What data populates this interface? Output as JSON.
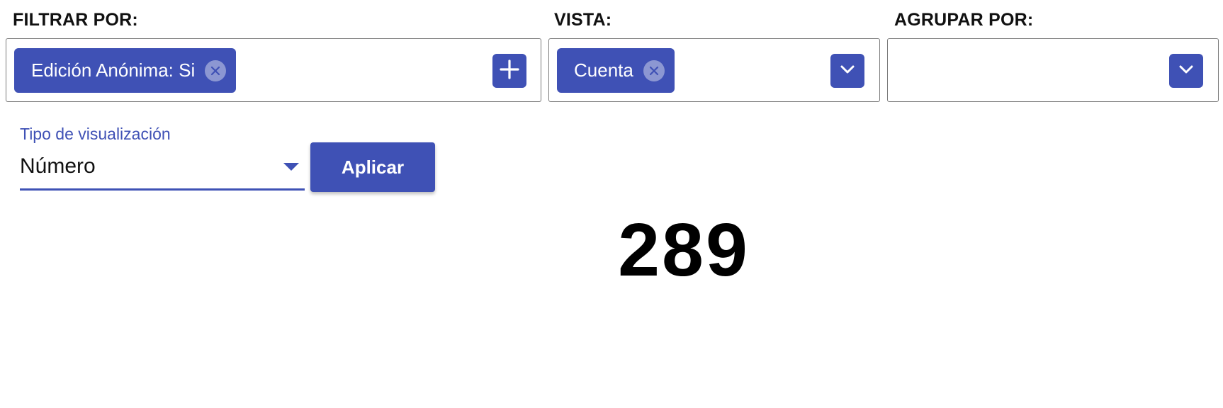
{
  "filters": {
    "filter_label": "FILTRAR POR:",
    "filter_chip": "Edición Anónima: Si",
    "view_label": "VISTA:",
    "view_chip": "Cuenta",
    "group_label": "AGRUPAR POR:"
  },
  "visualization": {
    "caption": "Tipo de visualización",
    "value": "Número",
    "apply_label": "Aplicar"
  },
  "result": {
    "value": "289"
  },
  "icons": {
    "chip_close": "close-circle-icon",
    "add": "plus-icon",
    "dropdown": "chevron-down-icon",
    "select_arrow": "caret-down-icon"
  },
  "colors": {
    "accent": "#3f51b5",
    "chip_close_bg": "#8c97d2",
    "border": "#7a7a7a"
  }
}
